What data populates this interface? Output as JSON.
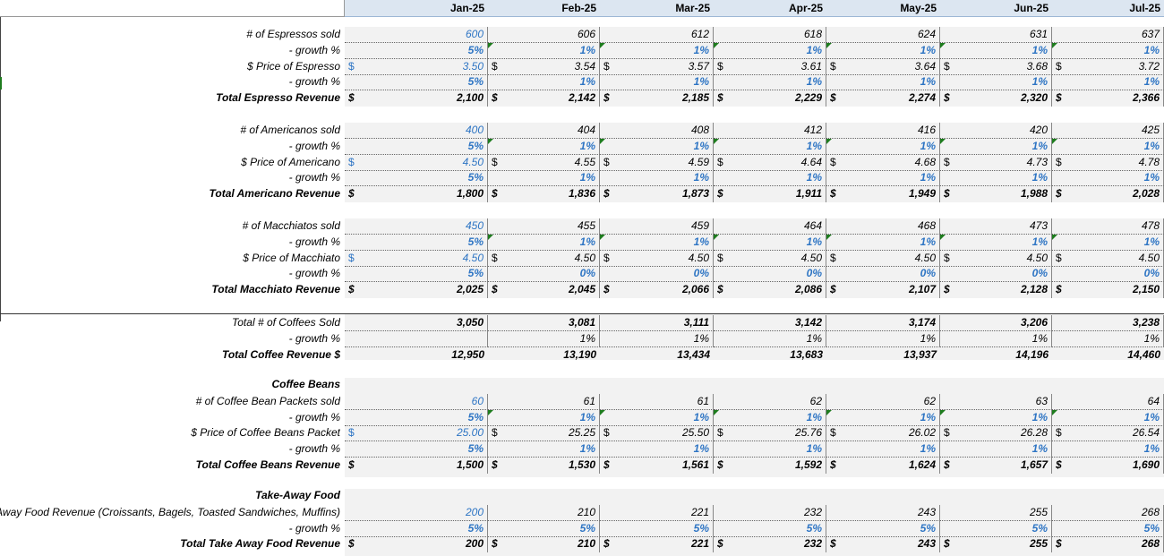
{
  "months": [
    "Jan-25",
    "Feb-25",
    "Mar-25",
    "Apr-25",
    "May-25",
    "Jun-25",
    "Jul-25"
  ],
  "blocks": [
    {
      "rows": [
        {
          "label": "# of Espressos sold",
          "style": "qty",
          "values": [
            "600",
            "606",
            "612",
            "618",
            "624",
            "631",
            "637"
          ]
        },
        {
          "label": "- growth %",
          "style": "pct",
          "values": [
            "5%",
            "1%",
            "1%",
            "1%",
            "1%",
            "1%",
            "1%"
          ]
        },
        {
          "label": "$ Price of Espresso",
          "style": "price",
          "values": [
            "3.50",
            "3.54",
            "3.57",
            "3.61",
            "3.64",
            "3.68",
            "3.72"
          ]
        },
        {
          "label": "- growth %",
          "style": "pct",
          "values": [
            "5%",
            "1%",
            "1%",
            "1%",
            "1%",
            "1%",
            "1%"
          ]
        },
        {
          "label": "Total Espresso Revenue",
          "style": "total",
          "values": [
            "2,100",
            "2,142",
            "2,185",
            "2,229",
            "2,274",
            "2,320",
            "2,366"
          ]
        }
      ]
    },
    {
      "rows": [
        {
          "label": "# of Americanos sold",
          "style": "qty",
          "values": [
            "400",
            "404",
            "408",
            "412",
            "416",
            "420",
            "425"
          ]
        },
        {
          "label": "- growth %",
          "style": "pct",
          "values": [
            "5%",
            "1%",
            "1%",
            "1%",
            "1%",
            "1%",
            "1%"
          ]
        },
        {
          "label": "$ Price of Americano",
          "style": "price",
          "values": [
            "4.50",
            "4.55",
            "4.59",
            "4.64",
            "4.68",
            "4.73",
            "4.78"
          ]
        },
        {
          "label": "- growth %",
          "style": "pct",
          "values": [
            "5%",
            "1%",
            "1%",
            "1%",
            "1%",
            "1%",
            "1%"
          ]
        },
        {
          "label": "Total Americano Revenue",
          "style": "total",
          "values": [
            "1,800",
            "1,836",
            "1,873",
            "1,911",
            "1,949",
            "1,988",
            "2,028"
          ]
        }
      ]
    },
    {
      "rows": [
        {
          "label": "# of Macchiatos sold",
          "style": "qty",
          "values": [
            "450",
            "455",
            "459",
            "464",
            "468",
            "473",
            "478"
          ]
        },
        {
          "label": "- growth %",
          "style": "pct",
          "values": [
            "5%",
            "1%",
            "1%",
            "1%",
            "1%",
            "1%",
            "1%"
          ]
        },
        {
          "label": "$ Price of Macchiato",
          "style": "price",
          "values": [
            "4.50",
            "4.50",
            "4.50",
            "4.50",
            "4.50",
            "4.50",
            "4.50"
          ]
        },
        {
          "label": "- growth %",
          "style": "pct",
          "values": [
            "5%",
            "0%",
            "0%",
            "0%",
            "0%",
            "0%",
            "0%"
          ]
        },
        {
          "label": "Total Macchiato Revenue",
          "style": "total",
          "values": [
            "2,025",
            "2,045",
            "2,066",
            "2,086",
            "2,107",
            "2,128",
            "2,150"
          ]
        }
      ]
    },
    {
      "rows": [
        {
          "label": "Total # of Coffees Sold",
          "style": "sumqty",
          "values": [
            "3,050",
            "3,081",
            "3,111",
            "3,142",
            "3,174",
            "3,206",
            "3,238"
          ]
        },
        {
          "label": "- growth %",
          "style": "sumpct",
          "values": [
            "",
            "1%",
            "1%",
            "1%",
            "1%",
            "1%",
            "1%"
          ]
        },
        {
          "label": "Total Coffee Revenue $",
          "style": "sumrev",
          "values": [
            "12,950",
            "13,190",
            "13,434",
            "13,683",
            "13,937",
            "14,196",
            "14,460"
          ]
        }
      ]
    },
    {
      "title": "Coffee Beans",
      "rows": [
        {
          "label": "# of Coffee Bean Packets sold",
          "style": "qty",
          "values": [
            "60",
            "61",
            "61",
            "62",
            "62",
            "63",
            "64"
          ]
        },
        {
          "label": "- growth %",
          "style": "pct",
          "values": [
            "5%",
            "1%",
            "1%",
            "1%",
            "1%",
            "1%",
            "1%"
          ]
        },
        {
          "label": "$ Price of Coffee Beans Packet",
          "style": "price",
          "values": [
            "25.00",
            "25.25",
            "25.50",
            "25.76",
            "26.02",
            "26.28",
            "26.54"
          ]
        },
        {
          "label": "- growth %",
          "style": "pct",
          "values": [
            "5%",
            "1%",
            "1%",
            "1%",
            "1%",
            "1%",
            "1%"
          ]
        },
        {
          "label": "Total Coffee Beans Revenue",
          "style": "total",
          "values": [
            "1,500",
            "1,530",
            "1,561",
            "1,592",
            "1,624",
            "1,657",
            "1,690"
          ]
        }
      ]
    },
    {
      "title": "Take-Away Food",
      "rows": [
        {
          "label": "Away Food Revenue (Croissants, Bagels, Toasted Sandwiches, Muffins)",
          "style": "qty2",
          "values": [
            "200",
            "210",
            "221",
            "232",
            "243",
            "255",
            "268"
          ]
        },
        {
          "label": "- growth %",
          "style": "pct2",
          "values": [
            "5%",
            "5%",
            "5%",
            "5%",
            "5%",
            "5%",
            "5%"
          ]
        },
        {
          "label": "Total Take Away Food Revenue",
          "style": "total",
          "values": [
            "200",
            "210",
            "221",
            "232",
            "243",
            "255",
            "268"
          ]
        }
      ]
    }
  ],
  "currency_symbol": "$",
  "colors": {
    "input_blue": "#2e75c4",
    "header_bg": "#dce6f1",
    "shade": "#f2f2f2",
    "flag_green": "#1e7c1e"
  }
}
